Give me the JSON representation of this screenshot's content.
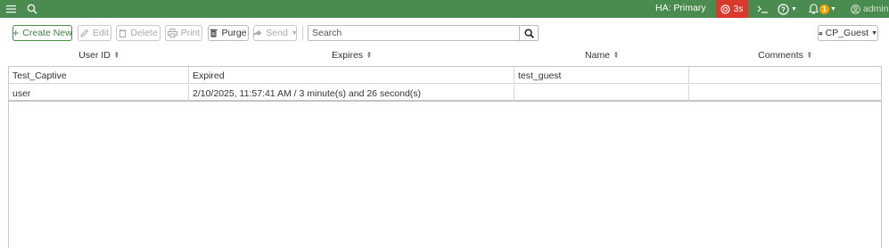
{
  "topbar": {
    "ha_label": "HA: Primary",
    "alert_count": "3s",
    "help_label": "",
    "notification_count": "1",
    "user_label": "admin",
    "colors": {
      "bar": "#4a8c50",
      "alert": "#d9382c",
      "notif": "#f0a000"
    }
  },
  "toolbar": {
    "create_label": "Create New",
    "edit_label": "Edit",
    "delete_label": "Delete",
    "print_label": "Print",
    "purge_label": "Purge",
    "send_label": "Send",
    "search_placeholder": "Search",
    "group_label": "CP_Guest"
  },
  "table": {
    "columns": [
      "User ID",
      "Expires",
      "Name",
      "Comments"
    ],
    "rows": [
      {
        "user_id": "Test_Captive",
        "expires": "Expired",
        "name": "test_guest",
        "comments": ""
      },
      {
        "user_id": "user",
        "expires": "2/10/2025, 11:57:41 AM / 3 minute(s) and 26 second(s)",
        "name": "",
        "comments": ""
      }
    ]
  }
}
